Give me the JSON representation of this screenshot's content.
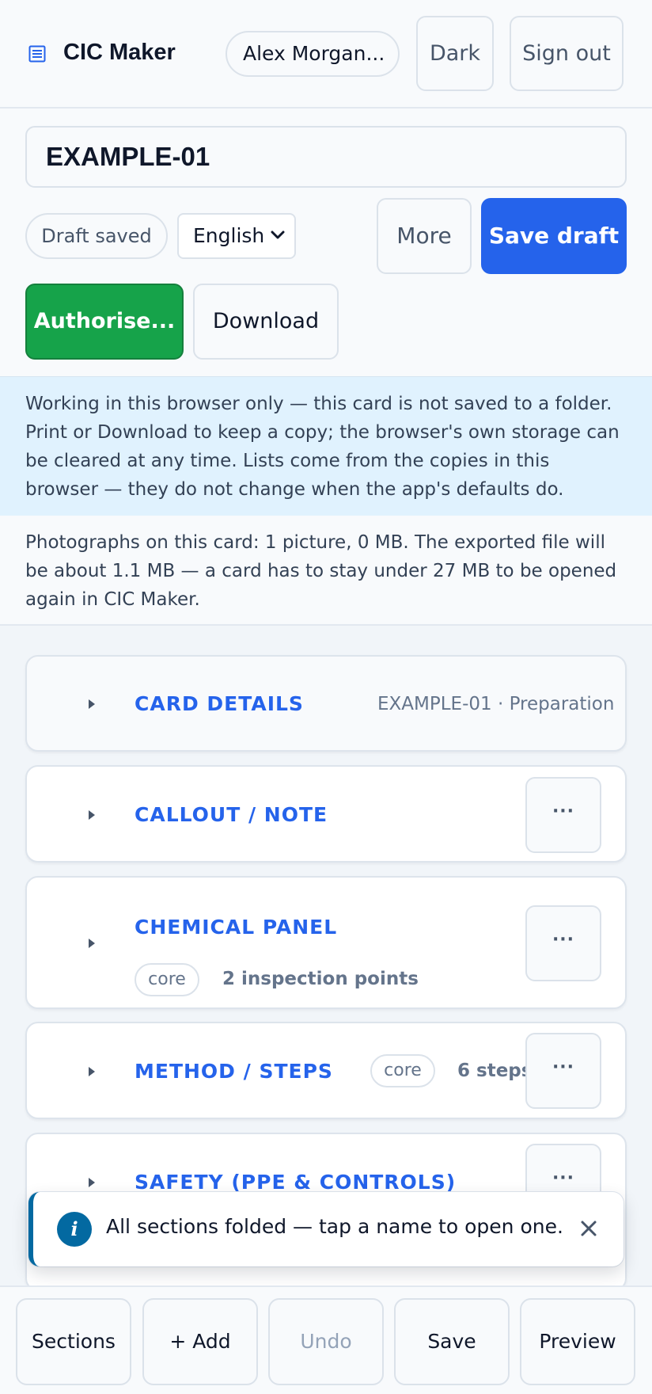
{
  "header": {
    "brand_icon": "document-list-icon",
    "brand_title": "CIC Maker",
    "user_name": "Alex Morgan...",
    "theme_button": "Dark",
    "sign_out_button": "Sign out"
  },
  "toolbar": {
    "card_title": "EXAMPLE-01",
    "save_status": "Draft saved",
    "language": {
      "selected": "English",
      "icon": "chevron-down-icon"
    },
    "more_button": "More",
    "save_draft_button": "Save draft",
    "authorise_button": "Authorise...",
    "download_button": "Download"
  },
  "notices": {
    "storage_notice": "Working in this browser only — this card is not saved to a folder. Print or Download to keep a copy; the browser's own storage can be cleared at any time. Lists come from the copies in this browser — they do not change when the app's defaults do.",
    "photos_notice": "Photographs on this card: 1 picture, 0 MB. The exported file will be about 1.1 MB — a card has to stay under 27 MB to be opened again in CIC Maker."
  },
  "sections": [
    {
      "title": "CARD DETAILS",
      "meta": "EXAMPLE-01 · Preparation"
    },
    {
      "title": "CALLOUT / NOTE",
      "menu": "···"
    },
    {
      "title": "CHEMICAL PANEL",
      "tag": "core",
      "meta": "2 inspection points",
      "menu": "···"
    },
    {
      "title": "METHOD / STEPS",
      "tag": "core",
      "meta": "6 steps",
      "menu": "···"
    },
    {
      "title": "SAFETY (PPE & CONTROLS)",
      "menu": "···"
    }
  ],
  "toast": {
    "icon": "info-icon",
    "icon_glyph": "i",
    "message": "All sections folded — tap a name to open one.",
    "close_icon": "close-icon"
  },
  "bottom_bar": {
    "sections_button": "Sections",
    "add_button": "+ Add",
    "undo_button": "Undo",
    "save_button": "Save",
    "preview_button": "Preview"
  },
  "colors": {
    "accent": "#2563eb",
    "success": "#16a34a",
    "info": "#0369a1",
    "notice_bg": "#e0f2fe"
  }
}
